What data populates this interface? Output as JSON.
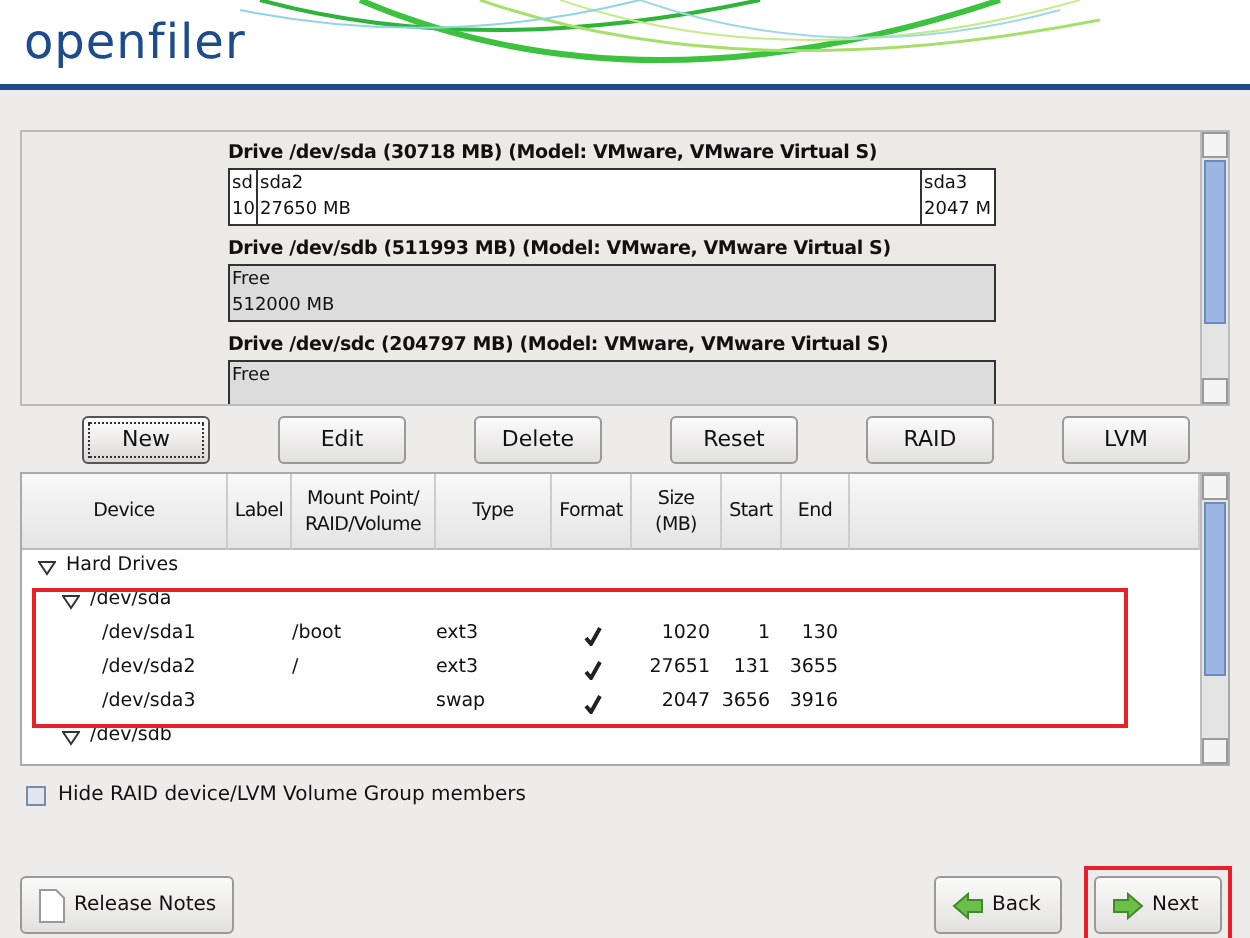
{
  "header": {
    "logo": "openfiler"
  },
  "drives": [
    {
      "title": "Drive /dev/sda (30718 MB) (Model: VMware, VMware Virtual S)",
      "segments": [
        {
          "kind": "sliver",
          "name": "sd",
          "size": "10"
        },
        {
          "kind": "main",
          "name": "sda2",
          "size": "27650 MB"
        },
        {
          "kind": "tail",
          "name": "sda3",
          "size": "2047 M"
        }
      ]
    },
    {
      "title": "Drive /dev/sdb (511993 MB) (Model: VMware, VMware Virtual S)",
      "segments": [
        {
          "kind": "free",
          "name": "Free",
          "size": "512000 MB"
        }
      ]
    },
    {
      "title": "Drive /dev/sdc (204797 MB) (Model: VMware, VMware Virtual S)",
      "segments": [
        {
          "kind": "free",
          "name": "Free"
        }
      ]
    }
  ],
  "actions": [
    {
      "label": "New",
      "selected": true
    },
    {
      "label": "Edit",
      "selected": false
    },
    {
      "label": "Delete",
      "selected": false
    },
    {
      "label": "Reset",
      "selected": false
    },
    {
      "label": "RAID",
      "selected": false
    },
    {
      "label": "LVM",
      "selected": false
    }
  ],
  "table": {
    "columns": [
      "Device",
      "Label",
      "Mount Point/\nRAID/Volume",
      "Type",
      "Format",
      "Size\n(MB)",
      "Start",
      "End"
    ],
    "tree": [
      {
        "device": "Hard Drives",
        "expanded": true,
        "children": [
          {
            "device": "/dev/sda",
            "expanded": true,
            "highlighted": true,
            "children": [
              {
                "device": "/dev/sda1",
                "mount": "/boot",
                "type": "ext3",
                "format": true,
                "size": "1020",
                "start": "1",
                "end": "130"
              },
              {
                "device": "/dev/sda2",
                "mount": "/",
                "type": "ext3",
                "format": true,
                "size": "27651",
                "start": "131",
                "end": "3655"
              },
              {
                "device": "/dev/sda3",
                "type": "swap",
                "format": true,
                "size": "2047",
                "start": "3656",
                "end": "3916"
              }
            ]
          },
          {
            "device": "/dev/sdb",
            "expanded": true
          }
        ]
      }
    ]
  },
  "hide_members": {
    "label": "Hide RAID device/LVM Volume Group members",
    "checked": false
  },
  "footer": {
    "release_notes": "Release Notes",
    "back": "Back",
    "next": "Next",
    "next_highlighted": true
  }
}
